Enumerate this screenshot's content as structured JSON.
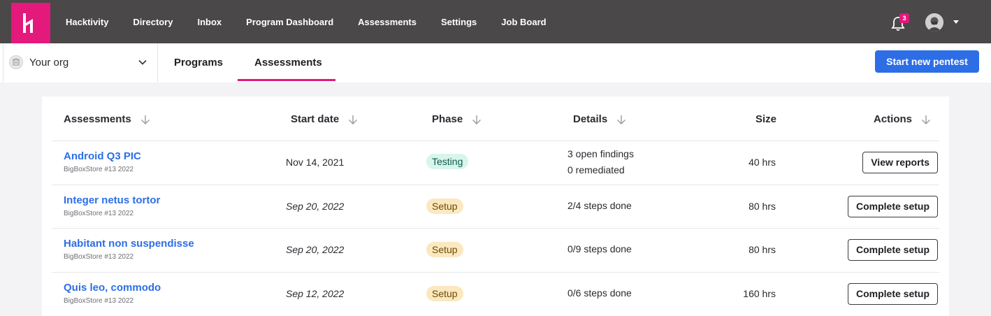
{
  "nav": {
    "links": [
      "Hacktivity",
      "Directory",
      "Inbox",
      "Program Dashboard",
      "Assessments",
      "Settings",
      "Job Board"
    ],
    "notification_count": "3"
  },
  "subnav": {
    "org_label": "Your org",
    "tabs": [
      "Programs",
      "Assessments"
    ],
    "active_tab": "Assessments",
    "start_button": "Start new pentest"
  },
  "table": {
    "headers": {
      "assessments": "Assessments",
      "start_date": "Start date",
      "phase": "Phase",
      "details": "Details",
      "size": "Size",
      "actions": "Actions"
    },
    "rows": [
      {
        "name": "Android Q3 PIC",
        "org": "BigBoxStore #13 2022",
        "start_date": "Nov 14, 2021",
        "phase": "Testing",
        "details_line1": "3 open findings",
        "details_line2": "0 remediated",
        "size": "40 hrs",
        "action": "View reports"
      },
      {
        "name": "Integer netus tortor",
        "org": "BigBoxStore #13 2022",
        "start_date": "Sep 20, 2022",
        "phase": "Setup",
        "details_line1": "2/4 steps done",
        "size": "80 hrs",
        "action": "Complete setup"
      },
      {
        "name": "Habitant non suspendisse",
        "org": "BigBoxStore #13 2022",
        "start_date": "Sep 20, 2022",
        "phase": "Setup",
        "details_line1": "0/9 steps done",
        "size": "80 hrs",
        "action": "Complete setup"
      },
      {
        "name": "Quis leo, commodo",
        "org": "BigBoxStore #13 2022",
        "start_date": "Sep 12, 2022",
        "phase": "Setup",
        "details_line1": "0/6 steps done",
        "size": "160 hrs",
        "action": "Complete setup"
      }
    ]
  },
  "colors": {
    "brand": "#e3197b",
    "nav_bg": "#4a4849",
    "primary": "#2d6ee6",
    "testing_bg": "#d7f5ec",
    "setup_bg": "#fbe8bf"
  },
  "icons": {
    "logo": "hackerone-logo",
    "bell": "bell-icon",
    "avatar": "user-avatar",
    "org": "building-icon",
    "chevron": "chevron-down-icon",
    "sort": "arrow-down-icon"
  }
}
